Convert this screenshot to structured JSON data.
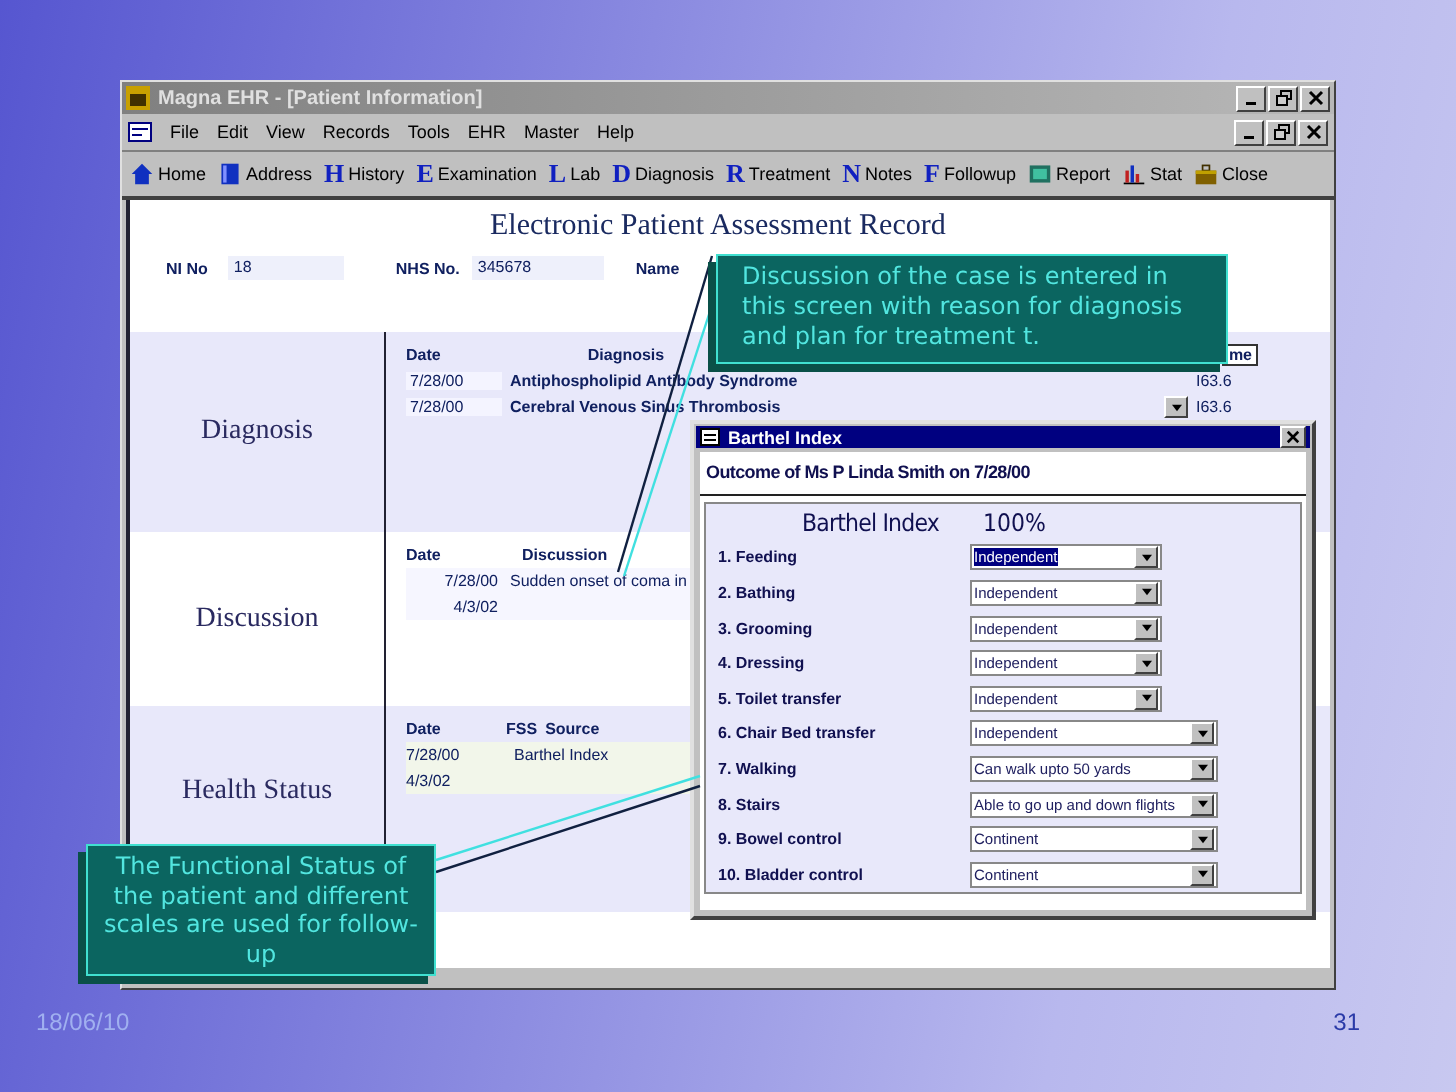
{
  "window": {
    "title": "Magna EHR - [Patient Information]"
  },
  "menu": [
    "File",
    "Edit",
    "View",
    "Records",
    "Tools",
    "EHR",
    "Master",
    "Help"
  ],
  "toolbar": [
    {
      "kind": "picture",
      "label": "Home"
    },
    {
      "kind": "picture",
      "label": "Address"
    },
    {
      "kind": "letter",
      "glyph": "H",
      "label": "History"
    },
    {
      "kind": "letter",
      "glyph": "E",
      "label": "Examination"
    },
    {
      "kind": "letter",
      "glyph": "L",
      "label": "Lab"
    },
    {
      "kind": "letter",
      "glyph": "D",
      "label": "Diagnosis"
    },
    {
      "kind": "letter",
      "glyph": "R",
      "label": "Treatment"
    },
    {
      "kind": "letter",
      "glyph": "N",
      "label": "Notes"
    },
    {
      "kind": "letter",
      "glyph": "F",
      "label": "Followup"
    },
    {
      "kind": "picture",
      "label": "Report"
    },
    {
      "kind": "picture",
      "label": "Stat"
    },
    {
      "kind": "picture",
      "label": "Close"
    }
  ],
  "record_title": "Electronic Patient Assessment Record",
  "ni_no": {
    "label": "NI No",
    "value": "18"
  },
  "nhs_no": {
    "label": "NHS No.",
    "value": "345678"
  },
  "name": {
    "label": "Name"
  },
  "diagnosis": {
    "title": "Diagnosis",
    "columns": [
      "Date",
      "Diagnosis",
      "me"
    ],
    "rows": [
      {
        "date": "7/28/00",
        "diagnosis": "Antiphospholipid Antibody Syndrome",
        "code": "I63.6",
        "dropdown": false
      },
      {
        "date": "7/28/00",
        "diagnosis": "Cerebral Venous Sinus Thrombosis",
        "code": "I63.6",
        "dropdown": true
      }
    ]
  },
  "discussion": {
    "title": "Discussion",
    "columns": [
      "Date",
      "Discussion"
    ],
    "rows": [
      {
        "date": "7/28/00",
        "text": "Sudden onset of coma in"
      },
      {
        "date": "4/3/02"
      }
    ]
  },
  "health_status": {
    "title": "Health Status",
    "columns": [
      "Date",
      "FSS",
      "Source"
    ],
    "rows": [
      {
        "date": "7/28/00",
        "source": "Barthel Index"
      },
      {
        "date": "4/3/02"
      }
    ]
  },
  "barthel": {
    "title": "Barthel Index",
    "outcome": "Outcome of Ms P Linda Smith on 7/28/00",
    "score_label": "Barthel Index",
    "score": "100%",
    "items": [
      {
        "label": "1. Feeding",
        "value": "Independent",
        "kind": "short",
        "selected": true
      },
      {
        "label": "2. Bathing",
        "value": "Independent",
        "kind": "short",
        "selected": false
      },
      {
        "label": "3. Grooming",
        "value": "Independent",
        "kind": "short",
        "selected": false
      },
      {
        "label": "4. Dressing",
        "value": "Independent",
        "kind": "short",
        "selected": false
      },
      {
        "label": "5. Toilet transfer",
        "value": "Independent",
        "kind": "short",
        "selected": false
      },
      {
        "label": "6. Chair Bed transfer",
        "value": "Independent",
        "kind": "long",
        "selected": false
      },
      {
        "label": "7. Walking",
        "value": "Can walk upto 50 yards",
        "kind": "long",
        "selected": false
      },
      {
        "label": "8. Stairs",
        "value": "Able to go up and down flights",
        "kind": "long",
        "selected": false
      },
      {
        "label": "9. Bowel control",
        "value": "Continent",
        "kind": "long",
        "selected": false
      },
      {
        "label": "10. Bladder control",
        "value": "Continent",
        "kind": "long",
        "selected": false
      }
    ]
  },
  "callouts": [
    {
      "text": "Discussion of the case is entered in this screen with reason for diagnosis and plan for treatment t."
    },
    {
      "text": "The Functional Status of the patient and different scales are used for follow-up"
    }
  ],
  "footer": {
    "date": "18/06/10",
    "page": "31"
  }
}
